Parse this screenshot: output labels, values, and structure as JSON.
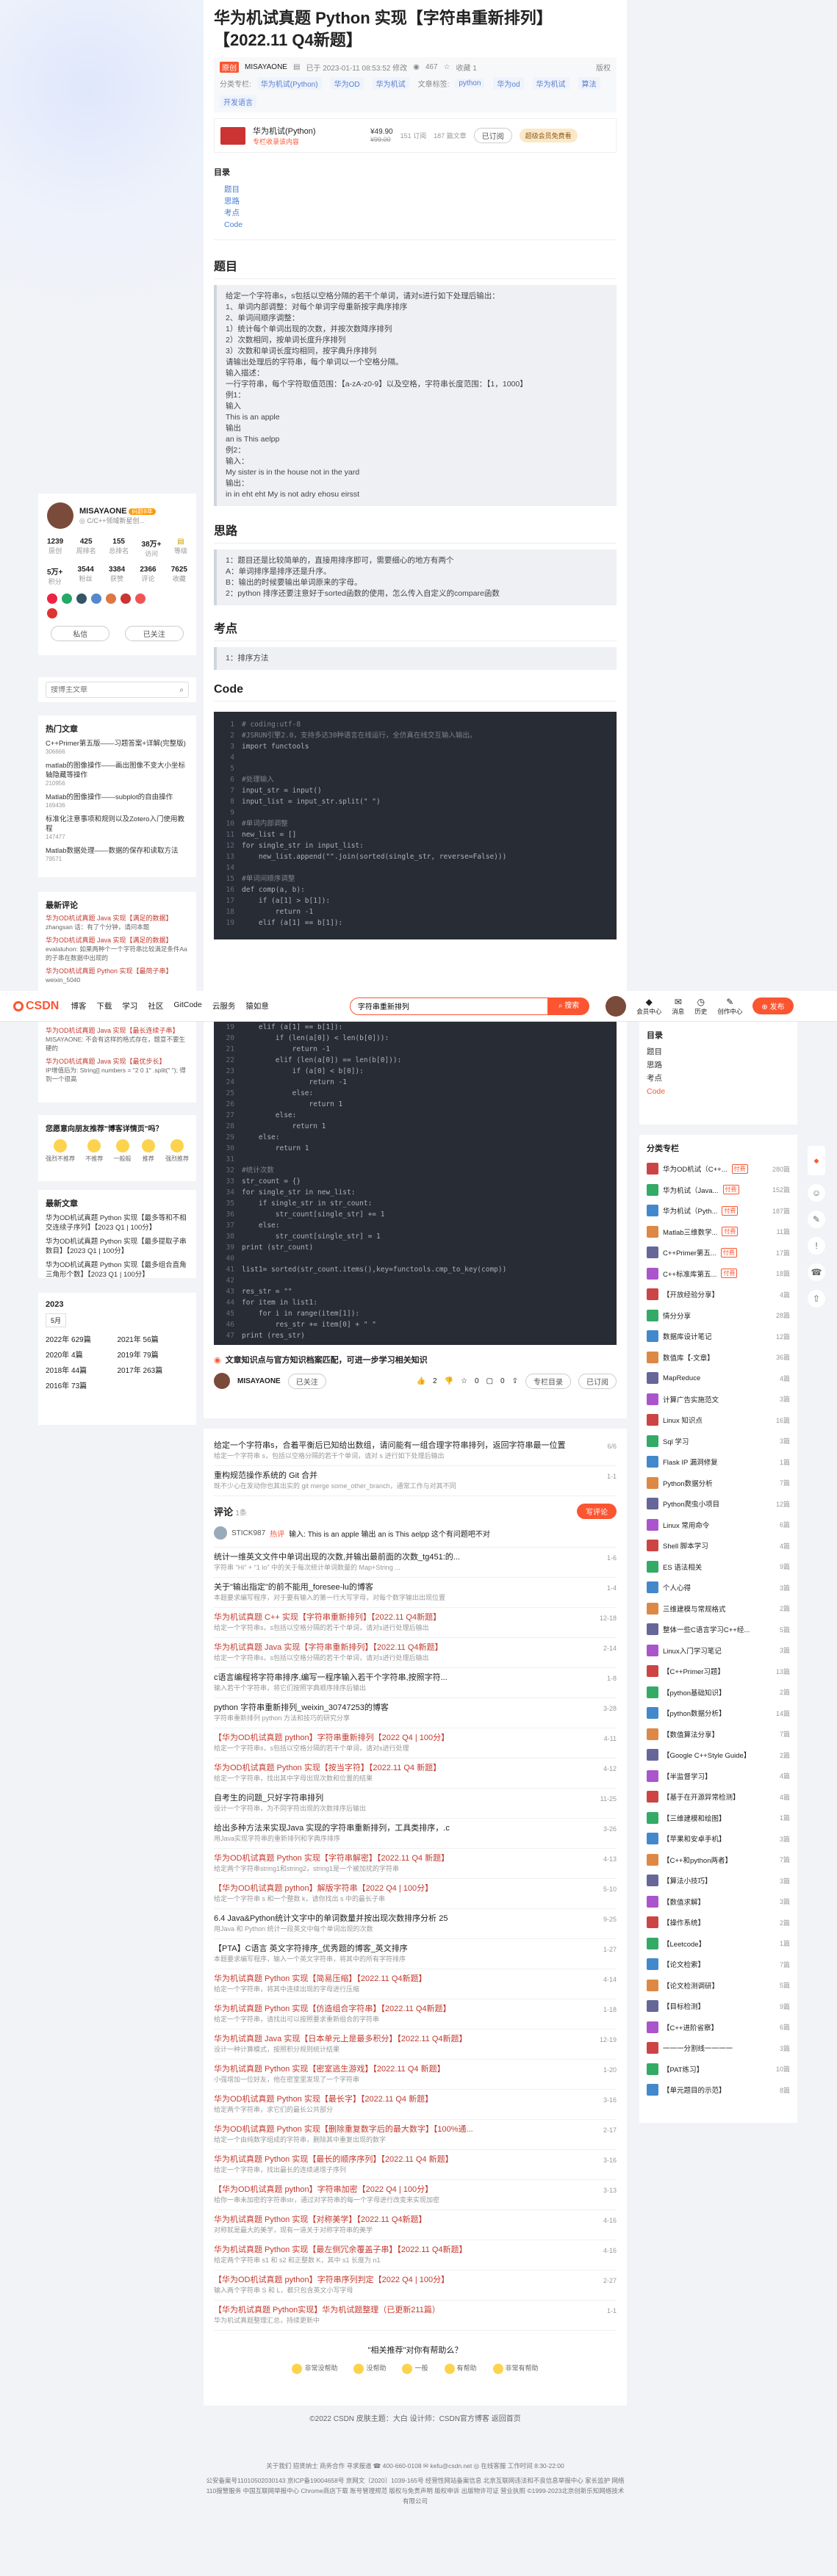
{
  "article": {
    "title": "华为机试真题 Python 实现【字符串重新排列】【2022.11 Q4新题】",
    "badge": "原创",
    "author": "MISAYAONE",
    "date": "已于 2023-01-11 08:53:52 修改",
    "views": "467",
    "favorites": "收藏 1",
    "edit": "版权",
    "column_label": "分类专栏:",
    "columns": [
      "华为机试(Python)",
      "华为OD",
      "华为机试"
    ],
    "tags_label": "文章标签:",
    "tags": [
      "python",
      "华为od",
      "华为机试",
      "算法",
      "开发语言"
    ],
    "column_card": {
      "name": "华为机试(Python)",
      "sub": "专栏收录该内容",
      "price": "¥49.90",
      "old_price": "¥99.00",
      "count1": "151 订阅",
      "count2": "187 篇文章",
      "sub_btn": "已订阅",
      "cta": "超级会员免费看"
    }
  },
  "toc": {
    "title": "目录",
    "items": [
      "题目",
      "思路",
      "考点",
      "Code"
    ]
  },
  "sections": {
    "problem": "题目",
    "problem_lines": [
      "给定一个字符串s，s包括以空格分隔的若干个单词，请对s进行如下处理后输出：",
      "1、单词内部调整：对每个单词字母重新按字典序排序",
      "2、单词间顺序调整：",
      "1）统计每个单词出现的次数，并按次数降序排列",
      "2）次数相同，按单词长度升序排列",
      "3）次数和单词长度均相同，按字典升序排列",
      "请输出处理后的字符串，每个单词以一个空格分隔。",
      "输入描述：",
      "一行字符串，每个字符取值范围：【a-zA-z0-9】以及空格，字符串长度范围：【1，1000】",
      "例1：",
      "输入",
      "This is an apple",
      "输出",
      "an is This aelpp",
      "例2：",
      "输入：",
      "My sister is in the house not in the yard",
      "输出：",
      "in in eht eht My is not adry ehosu eirsst"
    ],
    "idea": "思路",
    "idea_lines": [
      "1：题目还是比较简单的，直接用排序即可，需要细心的地方有两个",
      "A：单词排序是排序还是升序。",
      "B：输出的时候要输出单词原来的字母。",
      "2：python 排序还要注意好于sorted函数的使用，怎么传入自定义的compare函数"
    ],
    "point": "考点",
    "point_lines": [
      "1：排序方法"
    ],
    "code": "Code"
  },
  "code_lines": [
    "# coding:utf-8",
    "#JSRUN引擎2.0，支持多达30种语言在线运行，全仿真在线交互输入输出。",
    "import functools",
    "",
    "",
    "#处理输入",
    "input_str = input()",
    "input_list = input_str.split(\" \")",
    "",
    "#单词内部调整",
    "new_list = []",
    "for single_str in input_list:",
    "    new_list.append(\"\".join(sorted(single_str, reverse=False)))",
    "",
    "#单词间顺序调整",
    "def comp(a, b):",
    "    if (a[1] > b[1]):",
    "        return -1",
    "    elif (a[1] == b[1]):",
    "        if (len(a[0]) < len(b[0])):",
    "            return -1",
    "        elif (len(a[0]) == len(b[0])):",
    "            if (a[0] < b[0]):",
    "                return -1",
    "            else:",
    "                return 1",
    "        else:",
    "            return 1",
    "    else:",
    "        return 1",
    "",
    "#统计次数",
    "str_count = {}",
    "for single_str in new_list:",
    "    if single_str in str_count:",
    "        str_count[single_str] += 1",
    "    else:",
    "        str_count[single_str] = 1",
    "print (str_count)",
    "",
    "list1= sorted(str_count.items(),key=functools.cmp_to_key(comp))",
    "",
    "res_str = \"\"",
    "for item in list1:",
    "    for i in range(item[1]):",
    "        res_str += item[0] + \" \"",
    "print (res_str)"
  ],
  "footer_bar": {
    "text": "文章知识点与官方知识档案匹配，可进一步学习相关知识",
    "author": "MISAYAONE",
    "follow": "已关注",
    "likes": "2",
    "stars": "0",
    "comments": "0",
    "btn": "专栏目录",
    "btn2": "已订阅"
  },
  "profile": {
    "name": "MISAYAONE",
    "badge": "码龄8年",
    "sub": "◎ C/C++领域新星创...",
    "stats": [
      [
        "1239",
        "原创"
      ],
      [
        "425",
        "周排名"
      ],
      [
        "155",
        "总排名"
      ],
      [
        "38万+",
        "访问"
      ],
      [
        "等级",
        ""
      ]
    ],
    "stats2": [
      [
        "5万+",
        "积分"
      ],
      [
        "3544",
        "粉丝"
      ],
      [
        "3384",
        "获赞"
      ],
      [
        "2366",
        "评论"
      ],
      [
        "7625",
        "收藏"
      ]
    ],
    "btn_msg": "私信",
    "btn_follow": "已关注"
  },
  "search_placeholder": "搜博主文章",
  "hot": {
    "title": "热门文章",
    "items": [
      [
        "C++Primer第五版——习题答案+详解(完整版)",
        "306666"
      ],
      [
        "matlab的图像操作——画出图像不变大小坐标轴隐藏等操作",
        "210956"
      ],
      [
        "Matlab的图像操作——subplot的自由操作",
        "169436"
      ],
      [
        "标准化注意事项和规则以及Zotero入门使用教程",
        "147477"
      ],
      [
        "Matlab数据处理——数据的保存和读取方法",
        "79571"
      ]
    ]
  },
  "latest_comments": {
    "title": "最新评论",
    "items": [
      [
        "华为OD机试真题 Java 实现【满足的数据】",
        "zhangsan 话：有了个分钟，请问本题"
      ],
      [
        "华为OD机试真题 Java 实现【满足的数据】",
        "evalatuhon: 如果两种个一个字符串比较满足条件Aa的子串在数据中出现的"
      ],
      [
        "华为OD机试真题 Python 实现【最简子串】",
        "weixin_5040"
      ],
      [
        "华为OD机试真题 Java 实现【最长连续子串】",
        "MISAYAONE: 不会有这样的格式存在，题意不要生硬的"
      ],
      [
        "华为OD机试真题 Java 实现【最优步长】",
        "IP增值后为: String[] numbers = \"2 0 1\" .split(\" \"); 得到一个很高",
        ""
      ]
    ]
  },
  "feedback": {
    "title": "您愿意向朋友推荐\"博客详情页\"吗？",
    "opts": [
      "强烈不推荐",
      "不推荐",
      "一般般",
      "推荐",
      "强烈推荐"
    ]
  },
  "latest_articles": {
    "title": "最新文章",
    "items": [
      "华为OD机试真题 Python 实现【最多等和不相交连续子序列】【2023 Q1 | 100分】",
      "华为OD机试真题 Python 实现【最多提取子串数目】【2023 Q1 | 100分】",
      "华为OD机试真题 Python 实现【最多组合直角三角形个数】【2023 Q1 | 100分】"
    ]
  },
  "archive": {
    "year": "2023",
    "months": [
      "5月",
      "2022年 629篇",
      "2021年 56篇",
      "2020年 4篇",
      "2019年 79篇",
      "2018年 44篇",
      "2017年 263篇",
      "2016年 73篇"
    ]
  },
  "topnav": {
    "logo": "CSDN",
    "items": [
      "博客",
      "下载",
      "学习",
      "社区",
      "GitCode",
      "云服务",
      "猿如意"
    ],
    "search_value": "字符串重新排列",
    "search_btn": "搜索",
    "right": [
      "会员中心",
      "消息",
      "历史",
      "创作中心",
      "发布"
    ]
  },
  "toc2": {
    "title": "目录",
    "items": [
      "题目",
      "思路",
      "考点",
      "Code"
    ]
  },
  "cat": {
    "title": "分类专栏",
    "items": [
      [
        "华为OD机试（C++...",
        "付费",
        "280篇"
      ],
      [
        "华为机试（Java...",
        "付费",
        "152篇"
      ],
      [
        "华为机试（Pyth...",
        "付费",
        "187篇"
      ],
      [
        "Matlab三维数学...",
        "付费",
        "11篇"
      ],
      [
        "C++Primer第五...",
        "付费",
        "17篇"
      ],
      [
        "C++标准库第五...",
        "付费",
        "18篇"
      ],
      [
        "【开放经验分享】",
        "",
        "4篇"
      ],
      [
        "情分分享",
        "",
        "28篇"
      ],
      [
        "数据库设计笔记",
        "",
        "12篇"
      ],
      [
        "数值库【-文章】",
        "",
        "36篇"
      ],
      [
        "MapReduce",
        "",
        "4篇"
      ],
      [
        "计算广告实施范文",
        "",
        "3篇"
      ],
      [
        "Linux 知识点",
        "",
        "16篇"
      ],
      [
        "Sql 学习",
        "",
        "3篇"
      ],
      [
        "Flask IP 漏洞修复",
        "",
        "1篇"
      ],
      [
        "Python数据分析",
        "",
        "7篇"
      ],
      [
        "Python爬虫小项目",
        "",
        "12篇"
      ],
      [
        "Linux 常用命令",
        "",
        "6篇"
      ],
      [
        "Shell 脚本学习",
        "",
        "4篇"
      ],
      [
        "ES 语法相关",
        "",
        "9篇"
      ],
      [
        "个人心得",
        "",
        "3篇"
      ],
      [
        "三维建模与常规格式",
        "",
        "2篇"
      ],
      [
        "整体一些C语言学习C++经...",
        "",
        "5篇"
      ],
      [
        "Linux入门学习笔记",
        "",
        "3篇"
      ],
      [
        "【C++Primer习题】",
        "",
        "13篇"
      ],
      [
        "【python基础知识】",
        "",
        "2篇"
      ],
      [
        "【python数据分析】",
        "",
        "14篇"
      ],
      [
        "【数值算法分享】",
        "",
        "7篇"
      ],
      [
        "【Google C++Style Guide】",
        "",
        "2篇"
      ],
      [
        "【半监督学习】",
        "",
        "4篇"
      ],
      [
        "【基于在开源异常检测】",
        "",
        "4篇"
      ],
      [
        "【三维建模和绘图】",
        "",
        "1篇"
      ],
      [
        "【苹果和安卓手机】",
        "",
        "3篇"
      ],
      [
        "【C++和python两者】",
        "",
        "7篇"
      ],
      [
        "【算法小技巧】",
        "",
        "3篇"
      ],
      [
        "【数值求解】",
        "",
        "3篇"
      ],
      [
        "【操作系统】",
        "",
        "2篇"
      ],
      [
        "【Leetcode】",
        "",
        "1篇"
      ],
      [
        "【论文检索】",
        "",
        "7篇"
      ],
      [
        "【论文检测调研】",
        "",
        "5篇"
      ],
      [
        "【目标检测】",
        "",
        "9篇"
      ],
      [
        "【C++进阶省察】",
        "",
        "6篇"
      ],
      [
        "一一一分割线一一一一",
        "",
        "3篇"
      ],
      [
        "【PAT练习】",
        "",
        "10篇"
      ],
      [
        "【单元题目的示范】",
        "",
        "8篇"
      ]
    ]
  },
  "comment": {
    "title": "评论",
    "count": "1条",
    "btn": "写评论",
    "user": "STICK987",
    "user_tag": "热评",
    "text": "输入: This is an apple 输出 an is This aelpp 这个有问题吧不对"
  },
  "related": [
    [
      "给定一个字符串s，合着平衡后已知给出数组，请问能有一组合理字符串排列，返回字符串最一位置",
      "给定一个字符串 s，包括以空格分隔的若干个单词，请对 s 进行如下处理后输出",
      "6/6"
    ],
    [
      "重构规范操作系统的 Git 合并",
      "既不少心在发动你也其出实的 git merge some_other_branch，通常工作与对其不同",
      "1-1"
    ],
    [
      "统计一维英文文件中单词出现的次数,并输出最前面的次数_tg451:的...",
      "字符串 \"Hi\" + \"1 lo\" 中的关于每次统计单词数量的 Map+String ...",
      "1-6"
    ],
    [
      "关于\"输出指定\"的前不能用_foresee-lu的博客",
      "本题要求编写程序，对于要有输入的第一行大写字母，对每个数字输出出现位置",
      "1-4"
    ],
    [
      "华为机试真题 C++ 实现【字符串重新排列】【2022.11 Q4新题】",
      "给定一个字符串s，s包括以空格分隔的若干个单词，请对s进行处理后输出",
      "12-18"
    ],
    [
      "华为机试真题 Java 实现【字符串重新排列】【2022.11 Q4新题】",
      "给定一个字符串s，s包括以空格分隔的若干个单词，请对s进行处理后输出",
      "2-14"
    ],
    [
      "c语言编程将字符串排序,编写一程序输入若干个字符串,按照字符...",
      "输入若干个字符串，将它们按照字典顺序排序后输出",
      "1-8"
    ],
    [
      "python 字符串重新排列_weixin_30747253的博客",
      "字符串重新排列 python 方法和技巧的研究分享",
      "3-28"
    ],
    [
      "【华为OD机试真题 python】字符串重新排列【2022 Q4 | 100分】",
      "给定一个字符串s，s包括以空格分隔的若干个单词，请对s进行处理",
      "4-11"
    ],
    [
      "华为OD机试真题 Python 实现【按当字符】【2022.11 Q4 新题】",
      "给定一个字符串，找出其中字母出现次数和位置的结果",
      "4-12"
    ],
    [
      "自考生的问题_只好字符串排列",
      "设计一个字符串，为不同字符出现的次数排序后输出",
      "11-25"
    ],
    [
      "给出多种方法来实现Java 实现的字符串重新排列，工具类排序，.c",
      "用Java实现字符串的重新排列和字典序排序",
      "3-26"
    ],
    [
      "华为OD机试真题 Python 实现【字符串解密】【2022.11 Q4 新题】",
      "给定两个字符串string1和string2，string1是一个被加扰的字符串",
      "4-13"
    ],
    [
      "【华为OD机试真题 python】解版字符串【2022 Q4 | 100分】",
      "给定一个字符串 s 和一个整数 k，请你找出 s 中的最长子串",
      "5-10"
    ],
    [
      "6.4 Java&Python统计文字中的单词数量并按出现次数排序分析 25",
      "用Java 和 Python 统计一段英文中每个单词出现的次数",
      "9-25"
    ],
    [
      "【PTA】C语言 英文字符排序_优秀题的博客_英文排序",
      "本题要求编写程序，输入一个英文字符串，将其中的所有字符排序",
      "1-27"
    ],
    [
      "华为机试真题 Python 实现【简易压缩】【2022.11 Q4新题】",
      "给定一个字符串，将其中连续出现的字母进行压缩",
      "4-14"
    ],
    [
      "华为机试真题 Python 实现【仿造组合字符串】【2022.11 Q4新题】",
      "给定一个字符串，请找出可以按照要求重新组合的字符串",
      "1-18"
    ],
    [
      "华为机试真题 Java 实现【日本单元上是最多积分】【2022.11 Q4新题】",
      "设计一种计算模式，按照积分规则统计结果",
      "12-19"
    ],
    [
      "华为机试真题 Python 实现【密室逃生游戏】【2022.11 Q4 新题】",
      "小强增加一位好友，他在密室里发现了一个字符串",
      "1-20"
    ],
    [
      "华为OD机试真题 Python 实现【最长字】【2022.11 Q4 新题】",
      "给定两个字符串，求它们的最长公共部分",
      "3-16"
    ],
    [
      "华为OD机试真题 Python 实现【删除重复数字后的最大数字】【100%通...",
      "给定一个由纯数字组成的字符串，删除其中重复出现的数字",
      "2-17"
    ],
    [
      "华为机试真题 Python 实现【最长的顺序序列】【2022.11 Q4 新题】",
      "给定一个字符串，找出最长的连续递增子序列",
      "3-16"
    ],
    [
      "【华为OD机试真题 python】字符串加密【2022 Q4 | 100分】",
      "给你一串未加密的字符串str，通过对字符串的每一个字母进行改变来实现加密",
      "3-13"
    ],
    [
      "华为机试真题 Python 实现【对称美学】【2022.11 Q4新题】",
      "对称就是最大的美学，现有一道关于对称字符串的美学",
      "4-16"
    ],
    [
      "华为机试真题 Python 实现【最左侧冗余覆盖子串】【2022.11 Q4新题】",
      "给定两个字符串 s1 和 s2 和正整数 K，其中 s1 长度为 n1",
      "4-16"
    ],
    [
      "【华为OD机试真题 python】字符串序列判定【2022 Q4 | 100分】",
      "输入两个字符串 S 和 L，都只包含英文小写字母",
      "2-27"
    ],
    [
      "【华为机试真题 Python实现】华为机试题整理（已更新211篇）",
      "华为机试真题整理汇总，持续更新中",
      "1-1"
    ]
  ],
  "recommend_q": "\"相关推荐\"对你有帮助么？",
  "recommend_opts": [
    "非常没帮助",
    "没帮助",
    "一般",
    "有帮助",
    "非常有帮助"
  ],
  "copyright": "©2022 CSDN  皮肤主题：大白  设计师：CSDN官方博客  返回首页",
  "bottom_links": "关于我们  招贤纳士  商务合作  寻求报道  ☎ 400-660-0108  ✉ kefu@csdn.net  ◎ 在线客服  工作时间 8:30-22:00",
  "bottom_legal": "公安备案号11010502030143  京ICP备19004658号  京网文〔2020〕1039-165号  经营性网站备案信息  北京互联网违法和不良信息举报中心  家长监护  网络110报警服务  中国互联网举报中心  Chrome商店下载  账号管理规范  版权与免责声明  版权申诉  出版物许可证  营业执照  ©1999-2023北京创新乐知网络技术有限公司"
}
